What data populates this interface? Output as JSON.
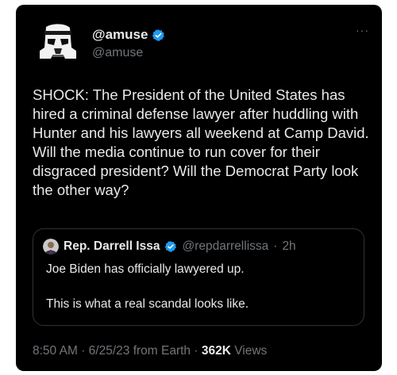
{
  "author": {
    "display_name": "@amuse",
    "handle": "@amuse",
    "avatar_icon": "stormtrooper-avatar",
    "verified_icon": "verified-badge-icon",
    "verified_color": "#1d9bf0"
  },
  "more_label": "···",
  "tweet": {
    "text": "SHOCK: The President of the United States has hired a criminal defense lawyer after huddling with Hunter and his lawyers all weekend at Camp David. Will the media continue to run cover for their disgraced president? Will the Democrat Party look the other way?"
  },
  "quoted": {
    "display_name": "Rep. Darrell Issa",
    "handle": "@repdarrellissa",
    "separator": "·",
    "time": "2h",
    "line1": "Joe Biden has officially lawyered up.",
    "line2": "This is what a real scandal looks like."
  },
  "meta": {
    "time": "8:50 AM",
    "sep1": "·",
    "date": "6/25/23",
    "source": "from Earth",
    "sep2": "·",
    "views_count": "362K",
    "views_label": "Views"
  },
  "colors": {
    "background": "#000000",
    "text": "#e7e9ea",
    "secondary": "#71767b",
    "border": "#2f3336",
    "accent": "#1d9bf0"
  }
}
